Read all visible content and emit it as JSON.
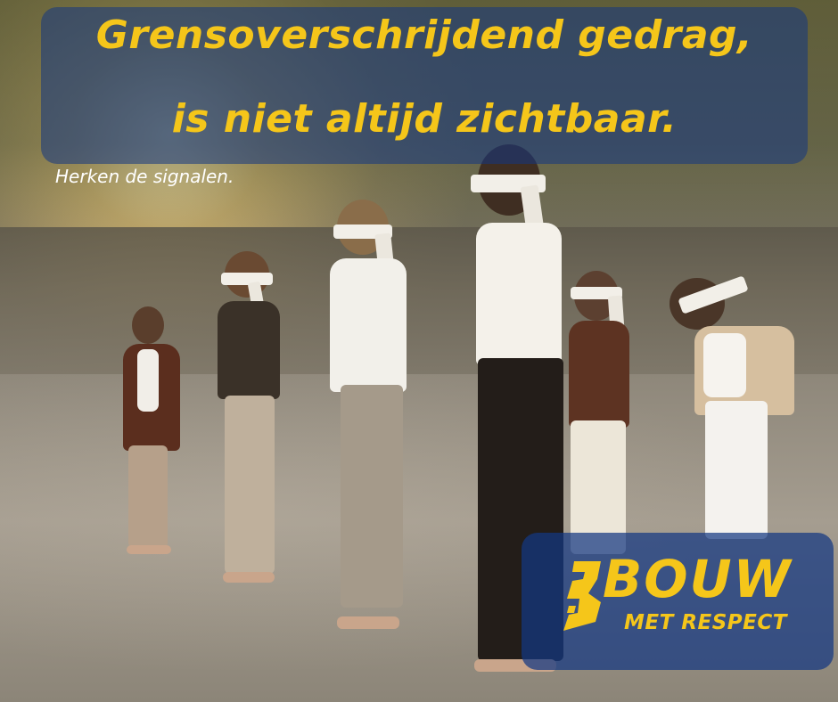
{
  "headline": {
    "line1": "Grensoverschrijdend gedrag,",
    "line2": "is niet altijd zichtbaar."
  },
  "subtitle": "Herken de signalen.",
  "logo": {
    "word": "BOUW",
    "sub": "MET RESPECT",
    "accent_color": "#f5c61a",
    "panel_color": "#143782"
  },
  "scene": {
    "description_icons": [
      "blindfolded-person"
    ]
  }
}
